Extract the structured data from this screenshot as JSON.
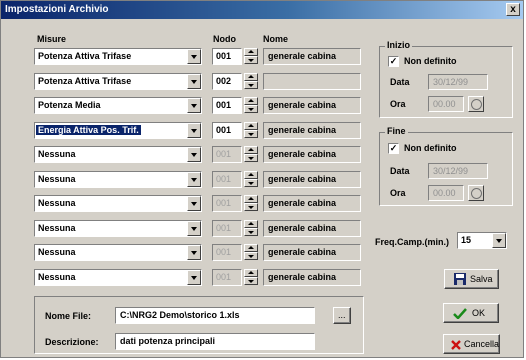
{
  "window": {
    "title": "Impostazioni Archivio",
    "close": "x"
  },
  "headers": {
    "misure": "Misure",
    "nodo": "Nodo",
    "nome": "Nome"
  },
  "rows": [
    {
      "misura": "Potenza Attiva Trifase",
      "nodo": "001",
      "nome": "generale cabina",
      "enabled": true,
      "selected": false
    },
    {
      "misura": "Potenza Attiva Trifase",
      "nodo": "002",
      "nome": "",
      "enabled": true,
      "selected": false
    },
    {
      "misura": "Potenza Media",
      "nodo": "001",
      "nome": "generale cabina",
      "enabled": true,
      "selected": false
    },
    {
      "misura": "Energia Attiva Pos. Trif.",
      "nodo": "001",
      "nome": "generale cabina",
      "enabled": true,
      "selected": true
    },
    {
      "misura": "Nessuna",
      "nodo": "001",
      "nome": "generale cabina",
      "enabled": false,
      "selected": false
    },
    {
      "misura": "Nessuna",
      "nodo": "001",
      "nome": "generale cabina",
      "enabled": false,
      "selected": false
    },
    {
      "misura": "Nessuna",
      "nodo": "001",
      "nome": "generale cabina",
      "enabled": false,
      "selected": false
    },
    {
      "misura": "Nessuna",
      "nodo": "001",
      "nome": "generale cabina",
      "enabled": false,
      "selected": false
    },
    {
      "misura": "Nessuna",
      "nodo": "001",
      "nome": "generale cabina",
      "enabled": false,
      "selected": false
    },
    {
      "misura": "Nessuna",
      "nodo": "001",
      "nome": "generale cabina",
      "enabled": false,
      "selected": false
    }
  ],
  "inizio": {
    "label": "Inizio",
    "check_label": "Non definito",
    "checked": true,
    "data_label": "Data",
    "data_value": "30/12/99",
    "ora_label": "Ora",
    "ora_value": "00.00"
  },
  "fine": {
    "label": "Fine",
    "check_label": "Non definito",
    "checked": true,
    "data_label": "Data",
    "data_value": "30/12/99",
    "ora_label": "Ora",
    "ora_value": "00.00"
  },
  "freq": {
    "label": "Freq.Camp.(min.)",
    "value": "15"
  },
  "file": {
    "nome_label": "Nome File:",
    "nome_value": "C:\\NRG2 Demo\\storico 1.xls",
    "browse": "...",
    "desc_label": "Descrizione:",
    "desc_value": "dati potenza principali"
  },
  "buttons": {
    "salva": "Salva",
    "ok": "OK",
    "cancella": "Cancella"
  },
  "colors": {
    "title_bg": "#0a246a",
    "face": "#d4d0c8",
    "ok_check": "#1a8a1a",
    "cancel_x": "#cc1111",
    "floppy": "#1a2a6a"
  }
}
